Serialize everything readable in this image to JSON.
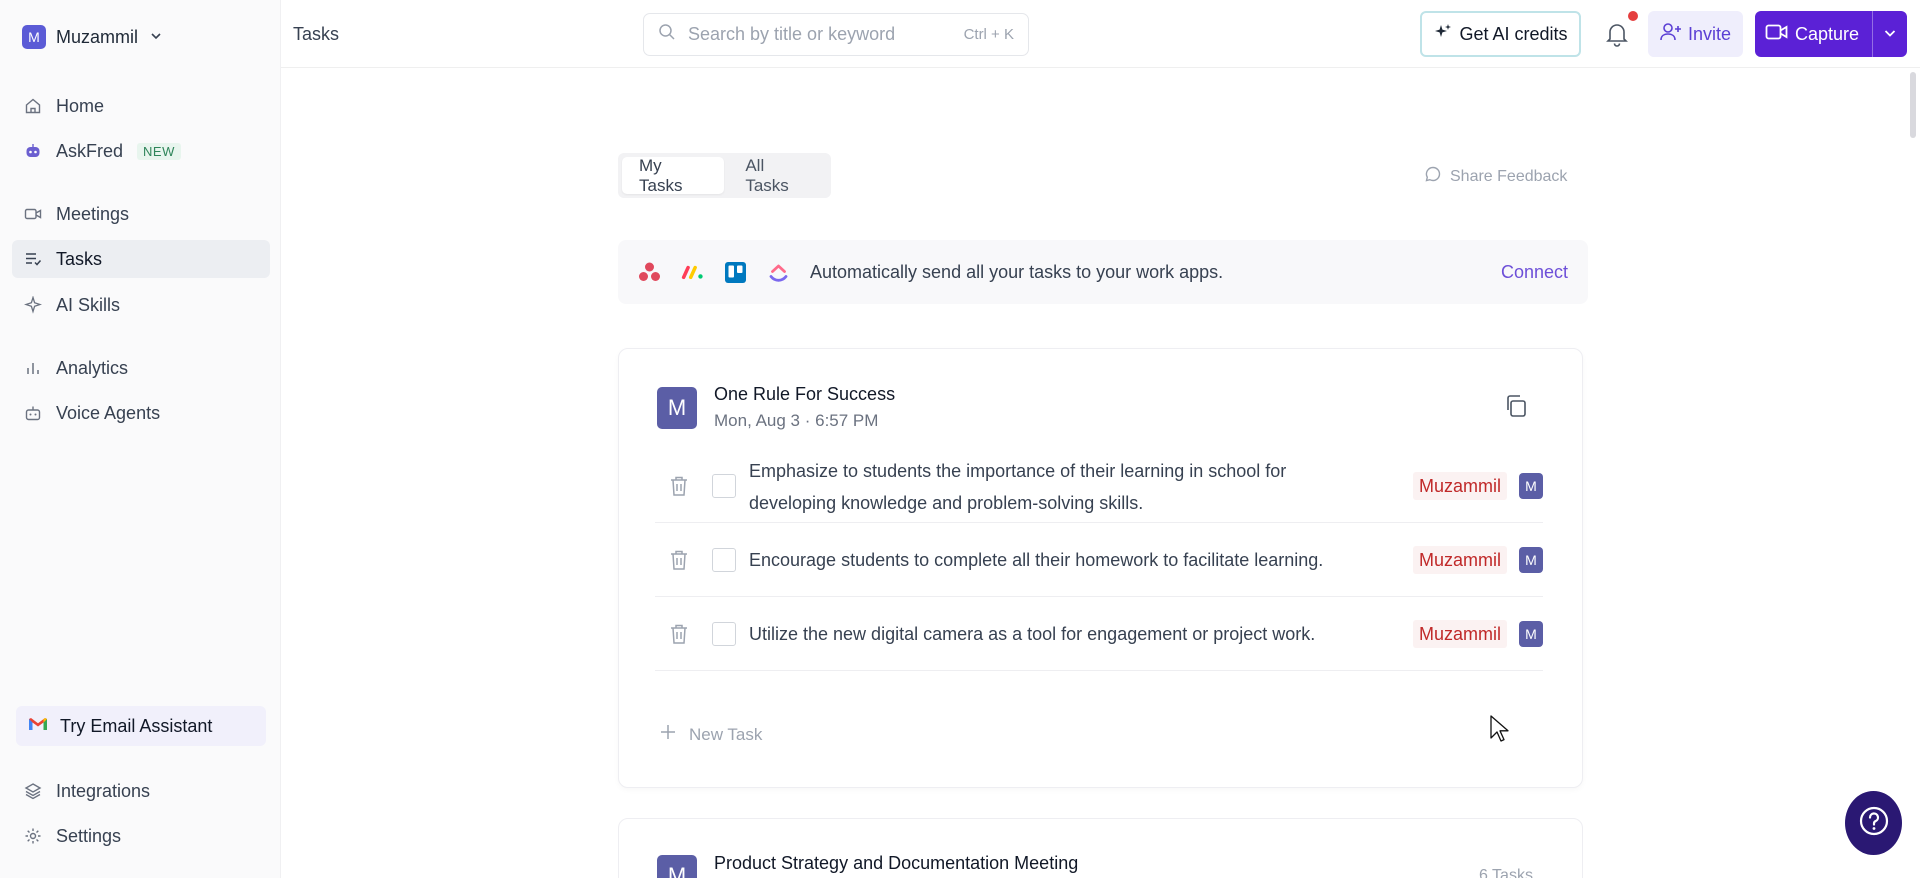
{
  "sidebar": {
    "workspace": {
      "avatar": "M",
      "name": "Muzammil"
    },
    "items": [
      {
        "label": "Home",
        "icon": "home-icon"
      },
      {
        "label": "AskFred",
        "icon": "robot-icon",
        "badge": "NEW"
      },
      {
        "label": "Meetings",
        "icon": "video-icon"
      },
      {
        "label": "Tasks",
        "icon": "tasks-icon",
        "active": true
      },
      {
        "label": "AI Skills",
        "icon": "sparkle-icon"
      },
      {
        "label": "Analytics",
        "icon": "bar-chart-icon"
      },
      {
        "label": "Voice Agents",
        "icon": "bot-icon"
      }
    ],
    "email_assistant": "Try Email Assistant",
    "bottom_items": [
      {
        "label": "Integrations",
        "icon": "layers-icon"
      },
      {
        "label": "Settings",
        "icon": "gear-icon"
      }
    ]
  },
  "topbar": {
    "title": "Tasks",
    "search_placeholder": "Search by title or keyword",
    "search_shortcut": "Ctrl + K",
    "credits_label": "Get AI credits",
    "invite_label": "Invite",
    "capture_label": "Capture"
  },
  "main": {
    "tabs": [
      {
        "label": "My Tasks",
        "active": true
      },
      {
        "label": "All Tasks",
        "active": false
      }
    ],
    "feedback_label": "Share Feedback",
    "banner": {
      "text": "Automatically send all your tasks to your work apps.",
      "link": "Connect"
    },
    "meetings": [
      {
        "avatar": "M",
        "title": "One Rule For Success",
        "subtitle": "Mon, Aug 3 · 6:57 PM",
        "tasks": [
          {
            "text": "Emphasize to students the importance of their learning in school for developing knowledge and problem-solving skills.",
            "assignee": "Muzammil",
            "assignee_avatar": "M"
          },
          {
            "text": "Encourage students to complete all their homework to facilitate learning.",
            "assignee": "Muzammil",
            "assignee_avatar": "M"
          },
          {
            "text": "Utilize the new digital camera as a tool for engagement or project work.",
            "assignee": "Muzammil",
            "assignee_avatar": "M"
          }
        ],
        "new_task_label": "New Task"
      },
      {
        "avatar": "M",
        "title": "Product Strategy and Documentation Meeting",
        "count": "6 Tasks"
      }
    ]
  },
  "colors": {
    "accent": "#5b21d6",
    "avatar": "#5b5ea6",
    "assignee_text": "#c02929"
  }
}
